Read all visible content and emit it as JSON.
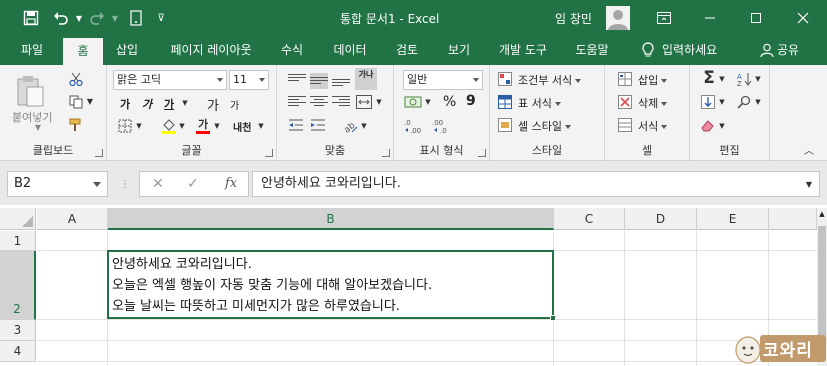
{
  "window": {
    "title": "통합 문서1  -  Excel",
    "user": "임 창민"
  },
  "menu": {
    "tabs": [
      "파일",
      "홈",
      "삽입",
      "페이지 레이아웃",
      "수식",
      "데이터",
      "검토",
      "보기",
      "개발 도구",
      "도움말"
    ],
    "active_tab": "홈",
    "tell_me": "입력하세요",
    "share": "공유"
  },
  "ribbon": {
    "clipboard": {
      "paste": "붙여넣기",
      "label": "클립보드"
    },
    "font": {
      "name": "맑은 고딕",
      "size": "11",
      "label": "글꼴",
      "grow": "가",
      "shrink": "가",
      "bold": "가",
      "italic": "가",
      "underline": "가",
      "color_letter": "가",
      "phonetic": "내천",
      "highlight_color": "#ffff00",
      "font_color": "#ff0000"
    },
    "alignment": {
      "label": "맞춤",
      "wrap": "가나"
    },
    "number": {
      "format": "일반",
      "label": "표시 형식",
      "percent": "%",
      "comma": "9"
    },
    "styles": {
      "conditional": "조건부 서식",
      "table": "표 서식",
      "cell": "셀 스타일",
      "label": "스타일"
    },
    "cells": {
      "insert": "삽입",
      "delete": "삭제",
      "format": "서식",
      "label": "셀"
    },
    "editing": {
      "label": "편집"
    }
  },
  "formula_bar": {
    "name_box": "B2",
    "formula": "안녕하세요 코와리입니다.",
    "fx": "fx"
  },
  "sheet": {
    "columns": [
      "A",
      "B",
      "C",
      "D",
      "E"
    ],
    "rows": [
      "1",
      "2",
      "3",
      "4"
    ],
    "selected_cell": "B2",
    "b2_lines": [
      "안녕하세요 코와리입니다.",
      "오늘은 엑셀 행높이 자동 맞춤 기능에 대해 알아보겠습니다.",
      "오늘 날씨는 따뜻하고 미세먼지가 많은 하루였습니다."
    ]
  },
  "watermark": {
    "text": "코와리"
  },
  "colors": {
    "accent": "#217346"
  }
}
